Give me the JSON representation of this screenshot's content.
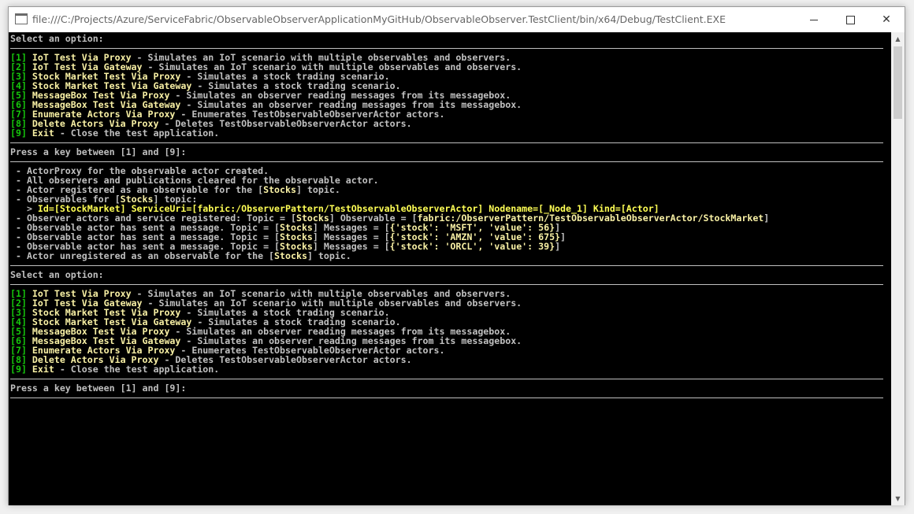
{
  "window": {
    "title": "file:///C:/Projects/Azure/ServiceFabric/ObservableObserverApplicationMyGitHub/ObservableObserver.TestClient/bin/x64/Debug/TestClient.EXE",
    "minimize_glyph": "",
    "close_glyph": "✕"
  },
  "console": {
    "lines": [
      {
        "t": "text",
        "segs": [
          {
            "c": "w",
            "s": "Select an option:"
          }
        ]
      },
      {
        "t": "rule"
      },
      {
        "t": "text",
        "segs": [
          {
            "c": "g",
            "s": "[1] "
          },
          {
            "c": "y",
            "s": "IoT Test Via Proxy"
          },
          {
            "c": "w",
            "s": " - Simulates an IoT scenario with multiple observables and observers."
          }
        ]
      },
      {
        "t": "text",
        "segs": [
          {
            "c": "g",
            "s": "[2] "
          },
          {
            "c": "y",
            "s": "IoT Test Via Gateway"
          },
          {
            "c": "w",
            "s": " - Simulates an IoT scenario with multiple observables and observers."
          }
        ]
      },
      {
        "t": "text",
        "segs": [
          {
            "c": "g",
            "s": "[3] "
          },
          {
            "c": "y",
            "s": "Stock Market Test Via Proxy"
          },
          {
            "c": "w",
            "s": " - Simulates a stock trading scenario."
          }
        ]
      },
      {
        "t": "text",
        "segs": [
          {
            "c": "g",
            "s": "[4] "
          },
          {
            "c": "y",
            "s": "Stock Market Test Via Gateway"
          },
          {
            "c": "w",
            "s": " - Simulates a stock trading scenario."
          }
        ]
      },
      {
        "t": "text",
        "segs": [
          {
            "c": "g",
            "s": "[5] "
          },
          {
            "c": "y",
            "s": "MessageBox Test Via Proxy"
          },
          {
            "c": "w",
            "s": " - Simulates an observer reading messages from its messagebox."
          }
        ]
      },
      {
        "t": "text",
        "segs": [
          {
            "c": "g",
            "s": "[6] "
          },
          {
            "c": "y",
            "s": "MessageBox Test Via Gateway"
          },
          {
            "c": "w",
            "s": " - Simulates an observer reading messages from its messagebox."
          }
        ]
      },
      {
        "t": "text",
        "segs": [
          {
            "c": "g",
            "s": "[7] "
          },
          {
            "c": "y",
            "s": "Enumerate Actors Via Proxy"
          },
          {
            "c": "w",
            "s": " - Enumerates TestObservableObserverActor actors."
          }
        ]
      },
      {
        "t": "text",
        "segs": [
          {
            "c": "g",
            "s": "[8] "
          },
          {
            "c": "y",
            "s": "Delete Actors Via Proxy"
          },
          {
            "c": "w",
            "s": " - Deletes TestObservableObserverActor actors."
          }
        ]
      },
      {
        "t": "text",
        "segs": [
          {
            "c": "g",
            "s": "[9] "
          },
          {
            "c": "y",
            "s": "Exit"
          },
          {
            "c": "w",
            "s": " - Close the test application."
          }
        ]
      },
      {
        "t": "rule"
      },
      {
        "t": "text",
        "segs": [
          {
            "c": "w",
            "s": "Press a key between [1] and [9]:"
          }
        ]
      },
      {
        "t": "rule"
      },
      {
        "t": "text",
        "segs": [
          {
            "c": "w",
            "s": " - ActorProxy for the observable actor created."
          }
        ]
      },
      {
        "t": "text",
        "segs": [
          {
            "c": "w",
            "s": " - All observers and publications cleared for the observable actor."
          }
        ]
      },
      {
        "t": "text",
        "segs": [
          {
            "c": "w",
            "s": " - Actor registered as an observable for the ["
          },
          {
            "c": "y",
            "s": "Stocks"
          },
          {
            "c": "w",
            "s": "] topic."
          }
        ]
      },
      {
        "t": "text",
        "segs": [
          {
            "c": "w",
            "s": " - Observables for ["
          },
          {
            "c": "y",
            "s": "Stocks"
          },
          {
            "c": "w",
            "s": "] topic:"
          }
        ]
      },
      {
        "t": "text",
        "segs": [
          {
            "c": "w",
            "s": "   > "
          },
          {
            "c": "ybright",
            "s": "Id=[StockMarket] ServiceUri=[fabric:/ObserverPattern/TestObservableObserverActor] Nodename=[_Node_1] Kind=[Actor]"
          }
        ]
      },
      {
        "t": "text",
        "segs": [
          {
            "c": "w",
            "s": " - Observer actors and service registered: Topic = ["
          },
          {
            "c": "y",
            "s": "Stocks"
          },
          {
            "c": "w",
            "s": "] Observable = ["
          },
          {
            "c": "y",
            "s": "fabric:/ObserverPattern/TestObservableObserverActor/StockMarket"
          },
          {
            "c": "w",
            "s": "]"
          }
        ]
      },
      {
        "t": "text",
        "segs": [
          {
            "c": "w",
            "s": " - Observable actor has sent a message. Topic = ["
          },
          {
            "c": "y",
            "s": "Stocks"
          },
          {
            "c": "w",
            "s": "] Messages = ["
          },
          {
            "c": "y",
            "s": "{'stock': 'MSFT', 'value': 56}"
          },
          {
            "c": "w",
            "s": "]"
          }
        ]
      },
      {
        "t": "text",
        "segs": [
          {
            "c": "w",
            "s": " - Observable actor has sent a message. Topic = ["
          },
          {
            "c": "y",
            "s": "Stocks"
          },
          {
            "c": "w",
            "s": "] Messages = ["
          },
          {
            "c": "y",
            "s": "{'stock': 'AMZN', 'value': 675}"
          },
          {
            "c": "w",
            "s": "]"
          }
        ]
      },
      {
        "t": "text",
        "segs": [
          {
            "c": "w",
            "s": " - Observable actor has sent a message. Topic = ["
          },
          {
            "c": "y",
            "s": "Stocks"
          },
          {
            "c": "w",
            "s": "] Messages = ["
          },
          {
            "c": "y",
            "s": "{'stock': 'ORCL', 'value': 39}"
          },
          {
            "c": "w",
            "s": "]"
          }
        ]
      },
      {
        "t": "text",
        "segs": [
          {
            "c": "w",
            "s": " - Actor unregistered as an observable for the ["
          },
          {
            "c": "y",
            "s": "Stocks"
          },
          {
            "c": "w",
            "s": "] topic."
          }
        ]
      },
      {
        "t": "rule"
      },
      {
        "t": "text",
        "segs": [
          {
            "c": "w",
            "s": "Select an option:"
          }
        ]
      },
      {
        "t": "rule"
      },
      {
        "t": "text",
        "segs": [
          {
            "c": "g",
            "s": "[1] "
          },
          {
            "c": "y",
            "s": "IoT Test Via Proxy"
          },
          {
            "c": "w",
            "s": " - Simulates an IoT scenario with multiple observables and observers."
          }
        ]
      },
      {
        "t": "text",
        "segs": [
          {
            "c": "g",
            "s": "[2] "
          },
          {
            "c": "y",
            "s": "IoT Test Via Gateway"
          },
          {
            "c": "w",
            "s": " - Simulates an IoT scenario with multiple observables and observers."
          }
        ]
      },
      {
        "t": "text",
        "segs": [
          {
            "c": "g",
            "s": "[3] "
          },
          {
            "c": "y",
            "s": "Stock Market Test Via Proxy"
          },
          {
            "c": "w",
            "s": " - Simulates a stock trading scenario."
          }
        ]
      },
      {
        "t": "text",
        "segs": [
          {
            "c": "g",
            "s": "[4] "
          },
          {
            "c": "y",
            "s": "Stock Market Test Via Gateway"
          },
          {
            "c": "w",
            "s": " - Simulates a stock trading scenario."
          }
        ]
      },
      {
        "t": "text",
        "segs": [
          {
            "c": "g",
            "s": "[5] "
          },
          {
            "c": "y",
            "s": "MessageBox Test Via Proxy"
          },
          {
            "c": "w",
            "s": " - Simulates an observer reading messages from its messagebox."
          }
        ]
      },
      {
        "t": "text",
        "segs": [
          {
            "c": "g",
            "s": "[6] "
          },
          {
            "c": "y",
            "s": "MessageBox Test Via Gateway"
          },
          {
            "c": "w",
            "s": " - Simulates an observer reading messages from its messagebox."
          }
        ]
      },
      {
        "t": "text",
        "segs": [
          {
            "c": "g",
            "s": "[7] "
          },
          {
            "c": "y",
            "s": "Enumerate Actors Via Proxy"
          },
          {
            "c": "w",
            "s": " - Enumerates TestObservableObserverActor actors."
          }
        ]
      },
      {
        "t": "text",
        "segs": [
          {
            "c": "g",
            "s": "[8] "
          },
          {
            "c": "y",
            "s": "Delete Actors Via Proxy"
          },
          {
            "c": "w",
            "s": " - Deletes TestObservableObserverActor actors."
          }
        ]
      },
      {
        "t": "text",
        "segs": [
          {
            "c": "g",
            "s": "[9] "
          },
          {
            "c": "y",
            "s": "Exit"
          },
          {
            "c": "w",
            "s": " - Close the test application."
          }
        ]
      },
      {
        "t": "rule"
      },
      {
        "t": "text",
        "segs": [
          {
            "c": "w",
            "s": "Press a key between [1] and [9]:"
          }
        ]
      },
      {
        "t": "rule"
      }
    ]
  },
  "colors": {
    "console_bg": "#000000",
    "text_default": "#c0c0c0",
    "menu_number": "#16c60c",
    "highlight_yellow": "#f9f1a5"
  },
  "icons": {
    "app": "console-app-icon",
    "minimize": "minimize-icon",
    "maximize": "maximize-icon",
    "close": "close-icon",
    "scroll_up": "scroll-up-arrow-icon",
    "scroll_down": "scroll-down-arrow-icon"
  }
}
